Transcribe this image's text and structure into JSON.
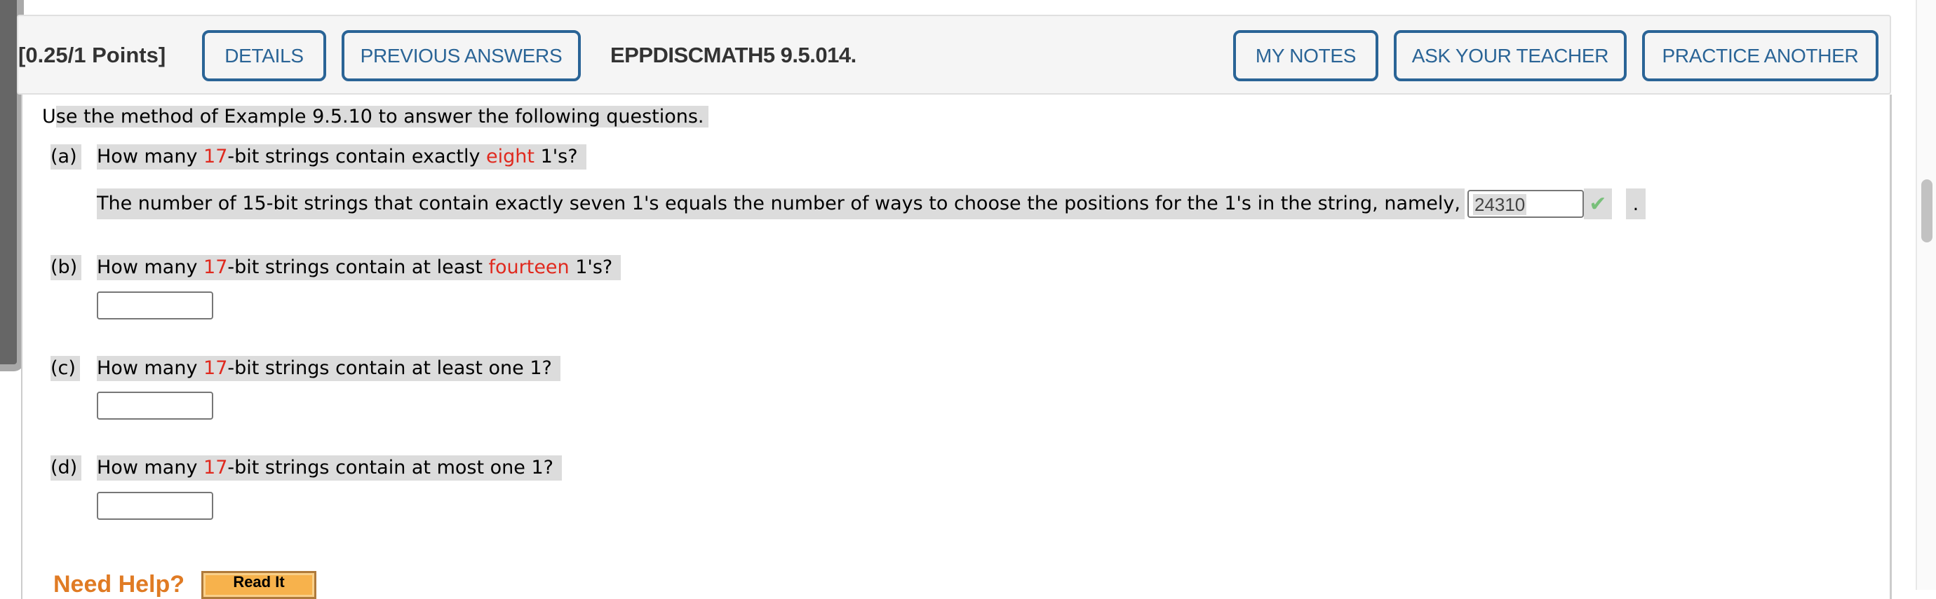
{
  "header": {
    "points": "[0.25/1 Points]",
    "buttons_left": [
      "DETAILS",
      "PREVIOUS ANSWERS"
    ],
    "question_id": "EPPDISCMATH5 9.5.014.",
    "buttons_right": [
      "MY NOTES",
      "ASK YOUR TEACHER",
      "PRACTICE ANOTHER"
    ]
  },
  "colors": {
    "button_accent": "#2a6496",
    "highlight_red": "#e0291e",
    "help_orange": "#e07b24",
    "check_green": "#78c07a"
  },
  "intro": {
    "first_char": "U",
    "rest": "se the method of Example 9.5.10 to answer the following questions."
  },
  "parts": [
    {
      "label": "(a)",
      "text_before": "How many ",
      "n": "17",
      "text_middle": "-bit strings contain exactly ",
      "k": "eight",
      "text_after": " 1's?",
      "answer_prefix": "The number of 15-bit strings that contain exactly seven 1's equals the number of ways to choose the positions for the 1's in the string, namely,",
      "answer_value": "24310",
      "answer_status": "correct",
      "answer_suffix": "."
    },
    {
      "label": "(b)",
      "text_before": "How many ",
      "n": "17",
      "text_middle": "-bit strings contain at least ",
      "k": "fourteen",
      "text_after": " 1's?",
      "answer_value": ""
    },
    {
      "label": "(c)",
      "text_before": "How many ",
      "n": "17",
      "text_after": "-bit strings contain at least one 1?",
      "answer_value": ""
    },
    {
      "label": "(d)",
      "text_before": "How many ",
      "n": "17",
      "text_after": "-bit strings contain at most one 1?",
      "answer_value": ""
    }
  ],
  "help": {
    "label": "Need Help?",
    "read_it": "Read It"
  },
  "icons": {
    "check": "✔"
  }
}
